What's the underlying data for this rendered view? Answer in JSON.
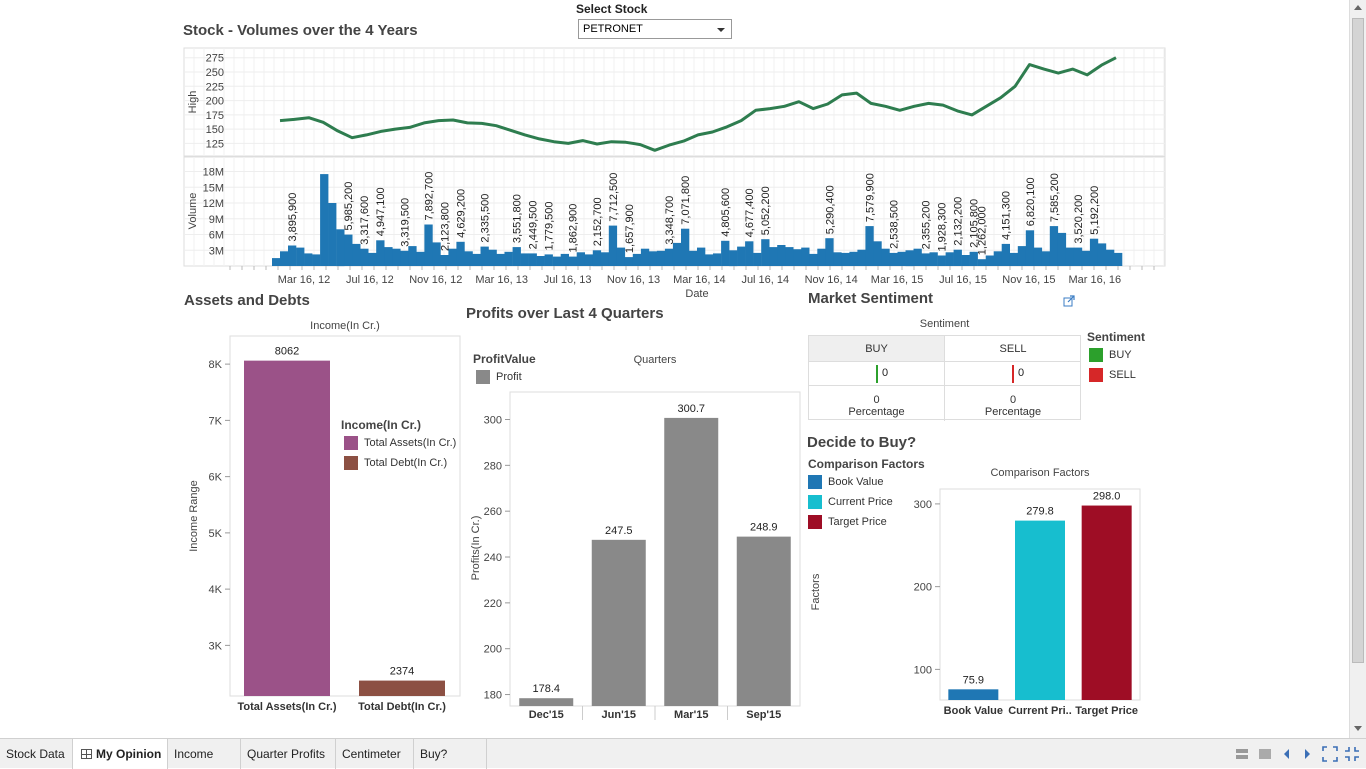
{
  "selector": {
    "label": "Select Stock",
    "value": "PETRONET"
  },
  "stock_panel": {
    "title": "Stock - Volumes over the 4 Years",
    "x_title": "Date"
  },
  "assets_panel": {
    "title": "Assets and Debts"
  },
  "profits_panel": {
    "title": "Profits over Last 4 Quarters"
  },
  "sentiment_panel": {
    "title": "Market Sentiment",
    "chart_title": "Sentiment",
    "col_buy": "BUY",
    "col_sell": "SELL",
    "buy_value": "0",
    "sell_value": "0",
    "buy_pct": "0",
    "sell_pct": "0",
    "pct_label": "Percentage",
    "legend_title": "Sentiment",
    "legend": [
      {
        "label": "BUY",
        "color": "#2ca02c"
      },
      {
        "label": "SELL",
        "color": "#d62728"
      }
    ]
  },
  "decide_panel": {
    "title": "Decide to Buy?"
  },
  "chart_data": [
    {
      "type": "line",
      "id": "high",
      "ylabel": "High",
      "yticks": [
        125,
        150,
        175,
        200,
        225,
        250,
        275
      ],
      "ylim": [
        110,
        285
      ],
      "color": "#2e7d4f",
      "points": [
        [
          0,
          165
        ],
        [
          0.5,
          167
        ],
        [
          1,
          170
        ],
        [
          1.5,
          162
        ],
        [
          2,
          147
        ],
        [
          2.5,
          135
        ],
        [
          3,
          140
        ],
        [
          3.5,
          146
        ],
        [
          4,
          150
        ],
        [
          4.5,
          153
        ],
        [
          5,
          161
        ],
        [
          5.5,
          165
        ],
        [
          6,
          166
        ],
        [
          6.5,
          161
        ],
        [
          7,
          160
        ],
        [
          7.5,
          156
        ],
        [
          8,
          148
        ],
        [
          8.5,
          140
        ],
        [
          9,
          133
        ],
        [
          9.5,
          128
        ],
        [
          10,
          125
        ],
        [
          10.5,
          130
        ],
        [
          11,
          124
        ],
        [
          11.5,
          128
        ],
        [
          12,
          127
        ],
        [
          12.5,
          123
        ],
        [
          13,
          113
        ],
        [
          13.5,
          122
        ],
        [
          14,
          129
        ],
        [
          14.5,
          140
        ],
        [
          15,
          145
        ],
        [
          15.5,
          154
        ],
        [
          16,
          165
        ],
        [
          16.5,
          183
        ],
        [
          17,
          186
        ],
        [
          17.5,
          190
        ],
        [
          18,
          198
        ],
        [
          18.5,
          186
        ],
        [
          19,
          194
        ],
        [
          19.5,
          210
        ],
        [
          20,
          213
        ],
        [
          20.5,
          195
        ],
        [
          21,
          190
        ],
        [
          21.5,
          183
        ],
        [
          22,
          190
        ],
        [
          22.5,
          195
        ],
        [
          23,
          192
        ],
        [
          23.5,
          182
        ],
        [
          24,
          175
        ],
        [
          24.5,
          190
        ],
        [
          25,
          205
        ],
        [
          25.5,
          225
        ],
        [
          26,
          263
        ],
        [
          26.5,
          255
        ],
        [
          27,
          248
        ],
        [
          27.5,
          255
        ],
        [
          28,
          245
        ],
        [
          28.5,
          262
        ],
        [
          29,
          275
        ]
      ]
    },
    {
      "type": "bar",
      "id": "volume",
      "ylabel": "Volume",
      "xlabel": "Date",
      "ytick_labels": [
        "3M",
        "6M",
        "9M",
        "12M",
        "15M",
        "18M"
      ],
      "ytick_values": [
        3,
        6,
        9,
        12,
        15,
        18
      ],
      "ylim": [
        0,
        20
      ],
      "color": "#1f77b4",
      "xtick_labels": [
        "Mar 16, 12",
        "Jul 16, 12",
        "Nov 16, 12",
        "Mar 16, 13",
        "Jul 16, 13",
        "Nov 16, 13",
        "Mar 16, 14",
        "Jul 16, 14",
        "Nov 16, 14",
        "Mar 16, 15",
        "Jul 16, 15",
        "Nov 16, 15",
        "Mar 16, 16"
      ],
      "values": [
        1.5,
        2.8,
        3.9,
        3.5,
        2.4,
        2.2,
        17.5,
        12,
        7,
        5.99,
        4.2,
        3.3,
        2.5,
        4.9,
        3.6,
        3.3,
        2.9,
        3.8,
        2.7,
        7.9,
        4.5,
        2.1,
        3.3,
        4.6,
        2.8,
        2.3,
        3.7,
        3.1,
        2.3,
        2.7,
        3.6,
        2.4,
        2.4,
        1.9,
        2.2,
        1.8,
        2.3,
        1.8,
        2.6,
        2.2,
        3.0,
        2.6,
        7.7,
        3.5,
        1.7,
        2.3,
        3.3,
        2.8,
        2.9,
        3.3,
        4.4,
        7.1,
        2.9,
        3.5,
        2.2,
        2.4,
        4.8,
        3.0,
        3.7,
        4.7,
        2.5,
        5.1,
        3.6,
        4.0,
        3.6,
        3.2,
        3.5,
        2.3,
        3.3,
        5.3,
        2.6,
        2.5,
        2.7,
        3.1,
        7.6,
        4.7,
        3.3,
        2.5,
        2.7,
        3.0,
        3.3,
        2.4,
        2.6,
        2.0,
        2.6,
        3.1,
        2.1,
        2.7,
        1.3,
        2.0,
        2.8,
        4.2,
        2.5,
        3.8,
        6.8,
        3.5,
        2.8,
        7.6,
        6.3,
        3.5,
        3.5,
        2.9,
        5.2,
        4.3,
        3.1,
        2.5
      ],
      "data_labels": [
        {
          "label": "3,895,900",
          "index": 2
        },
        {
          "label": "5,985,200",
          "index": 9
        },
        {
          "label": "3,317,600",
          "index": 11
        },
        {
          "label": "4,947,100",
          "index": 13
        },
        {
          "label": "3,319,500",
          "index": 16
        },
        {
          "label": "7,892,700",
          "index": 19
        },
        {
          "label": "2,123,800",
          "index": 21
        },
        {
          "label": "4,629,200",
          "index": 23
        },
        {
          "label": "2,335,500",
          "index": 26
        },
        {
          "label": "3,551,800",
          "index": 30
        },
        {
          "label": "2,449,500",
          "index": 32
        },
        {
          "label": "1,779,500",
          "index": 34
        },
        {
          "label": "1,862,900",
          "index": 37
        },
        {
          "label": "2,152,700",
          "index": 40
        },
        {
          "label": "7,712,500",
          "index": 42
        },
        {
          "label": "1,657,900",
          "index": 44
        },
        {
          "label": "3,348,700",
          "index": 49
        },
        {
          "label": "7,071,800",
          "index": 51
        },
        {
          "label": "4,805,600",
          "index": 56
        },
        {
          "label": "4,677,400",
          "index": 59
        },
        {
          "label": "5,052,200",
          "index": 61
        },
        {
          "label": "5,290,400",
          "index": 69
        },
        {
          "label": "7,579,900",
          "index": 74
        },
        {
          "label": "2,538,500",
          "index": 77
        },
        {
          "label": "2,355,200",
          "index": 81
        },
        {
          "label": "1,928,300",
          "index": 83
        },
        {
          "label": "2,132,200",
          "index": 85
        },
        {
          "label": "2,105,800",
          "index": 87
        },
        {
          "label": "1,262,000",
          "index": 88
        },
        {
          "label": "4,151,300",
          "index": 91
        },
        {
          "label": "6,820,100",
          "index": 94
        },
        {
          "label": "7,585,200",
          "index": 97
        },
        {
          "label": "3,520,200",
          "index": 100
        },
        {
          "label": "5,192,200",
          "index": 102
        }
      ]
    },
    {
      "type": "bar",
      "id": "assets",
      "title": "Income(In Cr.)",
      "ylabel": "Income Range",
      "ytick_labels": [
        "3K",
        "4K",
        "5K",
        "6K",
        "7K",
        "8K"
      ],
      "ytick_values": [
        3000,
        4000,
        5000,
        6000,
        7000,
        8000
      ],
      "ylim": [
        2100,
        8500
      ],
      "categories": [
        "Total Assets(In Cr.)",
        "Total Debt(In Cr.)"
      ],
      "values": [
        8062,
        2374
      ],
      "colors": [
        "#9b5288",
        "#8c5043"
      ],
      "legend_title": "Income(In Cr.)",
      "legend": [
        {
          "label": "Total Assets(In Cr.)",
          "color": "#9b5288"
        },
        {
          "label": "Total Debt(In Cr.)",
          "color": "#8c5043"
        }
      ]
    },
    {
      "type": "bar",
      "id": "profits",
      "title": "Quarters",
      "ylabel": "Profits(In Cr.)",
      "yticks": [
        180,
        200,
        220,
        240,
        260,
        280,
        300
      ],
      "ylim": [
        175,
        312
      ],
      "categories": [
        "Dec'15",
        "Jun'15",
        "Mar'15",
        "Sep'15"
      ],
      "values": [
        178.4,
        247.5,
        300.7,
        248.9
      ],
      "color": "#898989",
      "legend_title": "ProfitValue",
      "legend": [
        {
          "label": "Profit",
          "color": "#898989"
        }
      ]
    },
    {
      "type": "bar",
      "id": "factors",
      "title": "Comparison Factors",
      "ylabel": "Factors",
      "yticks": [
        100,
        200,
        300
      ],
      "ylim": [
        63,
        318
      ],
      "categories": [
        "Book Value",
        "Current Pri..",
        "Target Price"
      ],
      "values": [
        75.9,
        279.8,
        298.0
      ],
      "colors": [
        "#1f77b4",
        "#17becf",
        "#9e0d25"
      ],
      "legend_title": "Comparison Factors",
      "legend": [
        {
          "label": "Book Value",
          "color": "#1f77b4"
        },
        {
          "label": "Current Price",
          "color": "#17becf"
        },
        {
          "label": "Target Price",
          "color": "#9e0d25"
        }
      ]
    }
  ],
  "tabs": [
    {
      "label": "Stock Data",
      "active": false
    },
    {
      "label": "My Opinion",
      "active": true
    },
    {
      "label": "Income",
      "active": false
    },
    {
      "label": "Quarter Profits",
      "active": false
    },
    {
      "label": "Centimeter",
      "active": false
    },
    {
      "label": "Buy?",
      "active": false
    }
  ]
}
